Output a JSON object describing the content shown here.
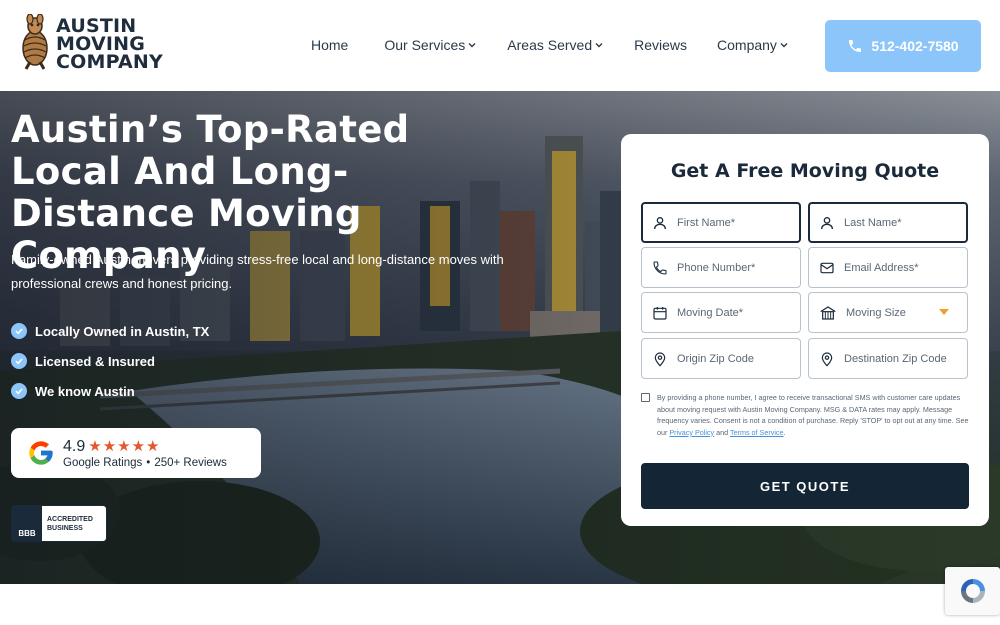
{
  "header": {
    "logo_lines": [
      "AUSTIN",
      "MOVING",
      "COMPANY"
    ],
    "nav": [
      {
        "label": "Home",
        "has_dropdown": false
      },
      {
        "label": "Our Services",
        "has_dropdown": true
      },
      {
        "label": "Areas Served",
        "has_dropdown": true
      },
      {
        "label": "Reviews",
        "has_dropdown": false
      },
      {
        "label": "Company",
        "has_dropdown": true
      }
    ],
    "phone": "512-402-7580"
  },
  "hero": {
    "title": "Austin’s Top-Rated Local And Long-Distance Moving Company",
    "subtitle": "Family-owned Austin movers providing stress-free local and long-distance moves with professional crews and honest pricing.",
    "bullets": [
      "Locally Owned in Austin, TX",
      "Licensed & Insured",
      "We know Austin"
    ],
    "rating": {
      "score": "4.9",
      "stars": "★★★★★",
      "source": "Google Ratings",
      "separator": "•",
      "reviews": "250+ Reviews"
    },
    "bbb": {
      "seal": "BBB",
      "line1": "ACCREDITED",
      "line2": "BUSINESS"
    }
  },
  "quote_form": {
    "title": "Get A Free Moving Quote",
    "fields": {
      "first_name": "First Name*",
      "last_name": "Last Name*",
      "phone": "Phone Number*",
      "email": "Email Address*",
      "moving_date": "Moving Date*",
      "moving_size": "Moving Size",
      "origin_zip": "Origin Zip Code",
      "destination_zip": "Destination Zip Code"
    },
    "consent": {
      "text": "By providing a phone number, I agree to receive transactional SMS with customer care updates about moving request with Austin Moving Company. MSG & DATA rates may apply. Message frequency varies. Consent is not a condition of purchase. Reply 'STOP' to opt out at any time. See our ",
      "privacy_link": "Privacy Policy",
      "and": " and ",
      "terms_link": "Terms of Service",
      "end": "."
    },
    "submit": "GET QUOTE"
  },
  "colors": {
    "navy": "#1b2a3a",
    "accent_blue": "#8cc5fa",
    "star_orange": "#e4572e",
    "caret_orange": "#f0a030"
  }
}
